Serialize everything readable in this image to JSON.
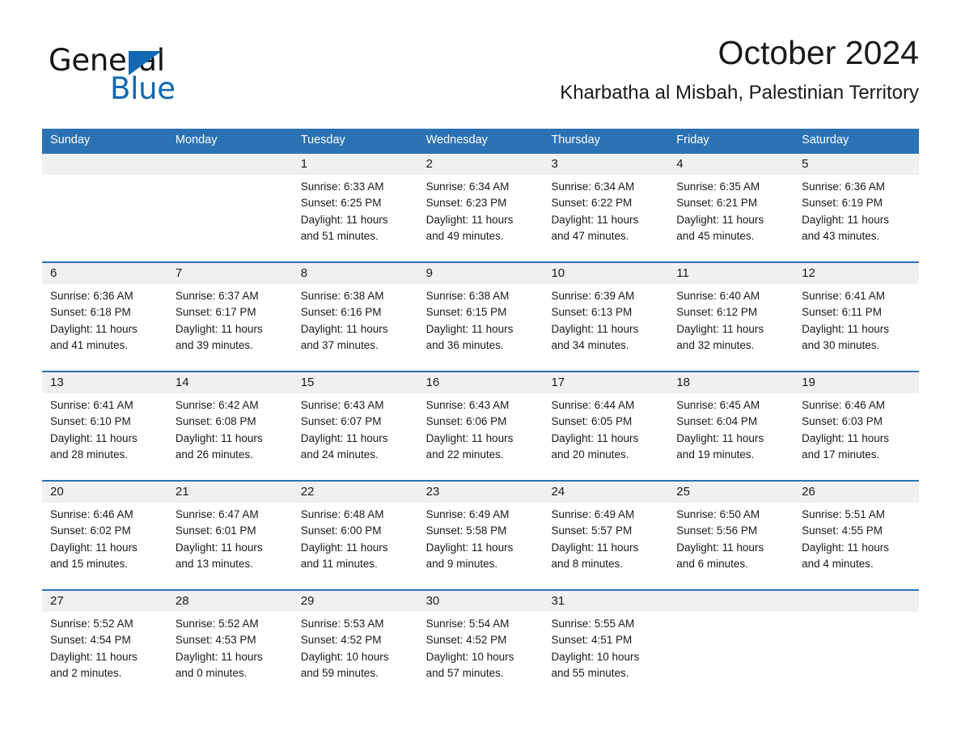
{
  "brand": {
    "name_part1": "General",
    "name_part2": "Blue",
    "triangle_color": "#1268b3"
  },
  "header": {
    "title": "October 2024",
    "subtitle": "Kharbatha al Misbah, Palestinian Territory",
    "accent_color": "#2b72b4",
    "number_band_color": "#f0f0f0"
  },
  "calendar": {
    "weekday_headers": [
      "Sunday",
      "Monday",
      "Tuesday",
      "Wednesday",
      "Thursday",
      "Friday",
      "Saturday"
    ],
    "weeks": [
      [
        {
          "day": "",
          "sunrise": "",
          "sunset": "",
          "daylight1": "",
          "daylight2": "",
          "empty": true
        },
        {
          "day": "",
          "sunrise": "",
          "sunset": "",
          "daylight1": "",
          "daylight2": "",
          "empty": true
        },
        {
          "day": "1",
          "sunrise": "Sunrise: 6:33 AM",
          "sunset": "Sunset: 6:25 PM",
          "daylight1": "Daylight: 11 hours",
          "daylight2": "and 51 minutes."
        },
        {
          "day": "2",
          "sunrise": "Sunrise: 6:34 AM",
          "sunset": "Sunset: 6:23 PM",
          "daylight1": "Daylight: 11 hours",
          "daylight2": "and 49 minutes."
        },
        {
          "day": "3",
          "sunrise": "Sunrise: 6:34 AM",
          "sunset": "Sunset: 6:22 PM",
          "daylight1": "Daylight: 11 hours",
          "daylight2": "and 47 minutes."
        },
        {
          "day": "4",
          "sunrise": "Sunrise: 6:35 AM",
          "sunset": "Sunset: 6:21 PM",
          "daylight1": "Daylight: 11 hours",
          "daylight2": "and 45 minutes."
        },
        {
          "day": "5",
          "sunrise": "Sunrise: 6:36 AM",
          "sunset": "Sunset: 6:19 PM",
          "daylight1": "Daylight: 11 hours",
          "daylight2": "and 43 minutes."
        }
      ],
      [
        {
          "day": "6",
          "sunrise": "Sunrise: 6:36 AM",
          "sunset": "Sunset: 6:18 PM",
          "daylight1": "Daylight: 11 hours",
          "daylight2": "and 41 minutes."
        },
        {
          "day": "7",
          "sunrise": "Sunrise: 6:37 AM",
          "sunset": "Sunset: 6:17 PM",
          "daylight1": "Daylight: 11 hours",
          "daylight2": "and 39 minutes."
        },
        {
          "day": "8",
          "sunrise": "Sunrise: 6:38 AM",
          "sunset": "Sunset: 6:16 PM",
          "daylight1": "Daylight: 11 hours",
          "daylight2": "and 37 minutes."
        },
        {
          "day": "9",
          "sunrise": "Sunrise: 6:38 AM",
          "sunset": "Sunset: 6:15 PM",
          "daylight1": "Daylight: 11 hours",
          "daylight2": "and 36 minutes."
        },
        {
          "day": "10",
          "sunrise": "Sunrise: 6:39 AM",
          "sunset": "Sunset: 6:13 PM",
          "daylight1": "Daylight: 11 hours",
          "daylight2": "and 34 minutes."
        },
        {
          "day": "11",
          "sunrise": "Sunrise: 6:40 AM",
          "sunset": "Sunset: 6:12 PM",
          "daylight1": "Daylight: 11 hours",
          "daylight2": "and 32 minutes."
        },
        {
          "day": "12",
          "sunrise": "Sunrise: 6:41 AM",
          "sunset": "Sunset: 6:11 PM",
          "daylight1": "Daylight: 11 hours",
          "daylight2": "and 30 minutes."
        }
      ],
      [
        {
          "day": "13",
          "sunrise": "Sunrise: 6:41 AM",
          "sunset": "Sunset: 6:10 PM",
          "daylight1": "Daylight: 11 hours",
          "daylight2": "and 28 minutes."
        },
        {
          "day": "14",
          "sunrise": "Sunrise: 6:42 AM",
          "sunset": "Sunset: 6:08 PM",
          "daylight1": "Daylight: 11 hours",
          "daylight2": "and 26 minutes."
        },
        {
          "day": "15",
          "sunrise": "Sunrise: 6:43 AM",
          "sunset": "Sunset: 6:07 PM",
          "daylight1": "Daylight: 11 hours",
          "daylight2": "and 24 minutes."
        },
        {
          "day": "16",
          "sunrise": "Sunrise: 6:43 AM",
          "sunset": "Sunset: 6:06 PM",
          "daylight1": "Daylight: 11 hours",
          "daylight2": "and 22 minutes."
        },
        {
          "day": "17",
          "sunrise": "Sunrise: 6:44 AM",
          "sunset": "Sunset: 6:05 PM",
          "daylight1": "Daylight: 11 hours",
          "daylight2": "and 20 minutes."
        },
        {
          "day": "18",
          "sunrise": "Sunrise: 6:45 AM",
          "sunset": "Sunset: 6:04 PM",
          "daylight1": "Daylight: 11 hours",
          "daylight2": "and 19 minutes."
        },
        {
          "day": "19",
          "sunrise": "Sunrise: 6:46 AM",
          "sunset": "Sunset: 6:03 PM",
          "daylight1": "Daylight: 11 hours",
          "daylight2": "and 17 minutes."
        }
      ],
      [
        {
          "day": "20",
          "sunrise": "Sunrise: 6:46 AM",
          "sunset": "Sunset: 6:02 PM",
          "daylight1": "Daylight: 11 hours",
          "daylight2": "and 15 minutes."
        },
        {
          "day": "21",
          "sunrise": "Sunrise: 6:47 AM",
          "sunset": "Sunset: 6:01 PM",
          "daylight1": "Daylight: 11 hours",
          "daylight2": "and 13 minutes."
        },
        {
          "day": "22",
          "sunrise": "Sunrise: 6:48 AM",
          "sunset": "Sunset: 6:00 PM",
          "daylight1": "Daylight: 11 hours",
          "daylight2": "and 11 minutes."
        },
        {
          "day": "23",
          "sunrise": "Sunrise: 6:49 AM",
          "sunset": "Sunset: 5:58 PM",
          "daylight1": "Daylight: 11 hours",
          "daylight2": "and 9 minutes."
        },
        {
          "day": "24",
          "sunrise": "Sunrise: 6:49 AM",
          "sunset": "Sunset: 5:57 PM",
          "daylight1": "Daylight: 11 hours",
          "daylight2": "and 8 minutes."
        },
        {
          "day": "25",
          "sunrise": "Sunrise: 6:50 AM",
          "sunset": "Sunset: 5:56 PM",
          "daylight1": "Daylight: 11 hours",
          "daylight2": "and 6 minutes."
        },
        {
          "day": "26",
          "sunrise": "Sunrise: 5:51 AM",
          "sunset": "Sunset: 4:55 PM",
          "daylight1": "Daylight: 11 hours",
          "daylight2": "and 4 minutes."
        }
      ],
      [
        {
          "day": "27",
          "sunrise": "Sunrise: 5:52 AM",
          "sunset": "Sunset: 4:54 PM",
          "daylight1": "Daylight: 11 hours",
          "daylight2": "and 2 minutes."
        },
        {
          "day": "28",
          "sunrise": "Sunrise: 5:52 AM",
          "sunset": "Sunset: 4:53 PM",
          "daylight1": "Daylight: 11 hours",
          "daylight2": "and 0 minutes."
        },
        {
          "day": "29",
          "sunrise": "Sunrise: 5:53 AM",
          "sunset": "Sunset: 4:52 PM",
          "daylight1": "Daylight: 10 hours",
          "daylight2": "and 59 minutes."
        },
        {
          "day": "30",
          "sunrise": "Sunrise: 5:54 AM",
          "sunset": "Sunset: 4:52 PM",
          "daylight1": "Daylight: 10 hours",
          "daylight2": "and 57 minutes."
        },
        {
          "day": "31",
          "sunrise": "Sunrise: 5:55 AM",
          "sunset": "Sunset: 4:51 PM",
          "daylight1": "Daylight: 10 hours",
          "daylight2": "and 55 minutes."
        },
        {
          "day": "",
          "sunrise": "",
          "sunset": "",
          "daylight1": "",
          "daylight2": "",
          "empty": true
        },
        {
          "day": "",
          "sunrise": "",
          "sunset": "",
          "daylight1": "",
          "daylight2": "",
          "empty": true
        }
      ]
    ]
  }
}
